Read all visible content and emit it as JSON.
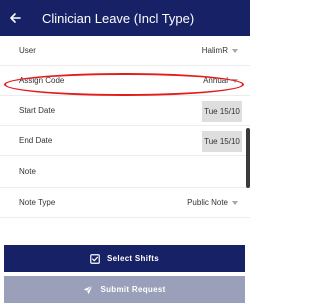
{
  "header": {
    "title": "Clinician Leave (Incl Type)",
    "back_icon": "arrow-left-icon"
  },
  "form": {
    "user": {
      "label": "User",
      "value": "HalimR"
    },
    "assign_code": {
      "label": "Assign Code",
      "value": "Annual"
    },
    "start_date": {
      "label": "Start Date",
      "value": "Tue 15/10"
    },
    "end_date": {
      "label": "End Date",
      "value": "Tue 15/10"
    },
    "note": {
      "label": "Note",
      "value": ""
    },
    "note_type": {
      "label": "Note Type",
      "value": "Public Note"
    }
  },
  "actions": {
    "select_shifts": {
      "label": "Select Shifts",
      "icon": "checkbox-icon"
    },
    "submit_request": {
      "label": "Submit Request",
      "icon": "send-icon"
    }
  },
  "colors": {
    "header_bg": "#172266",
    "primary_button": "#172266",
    "disabled_button": "#9aa0b9",
    "annotation": "#e51b1b"
  }
}
